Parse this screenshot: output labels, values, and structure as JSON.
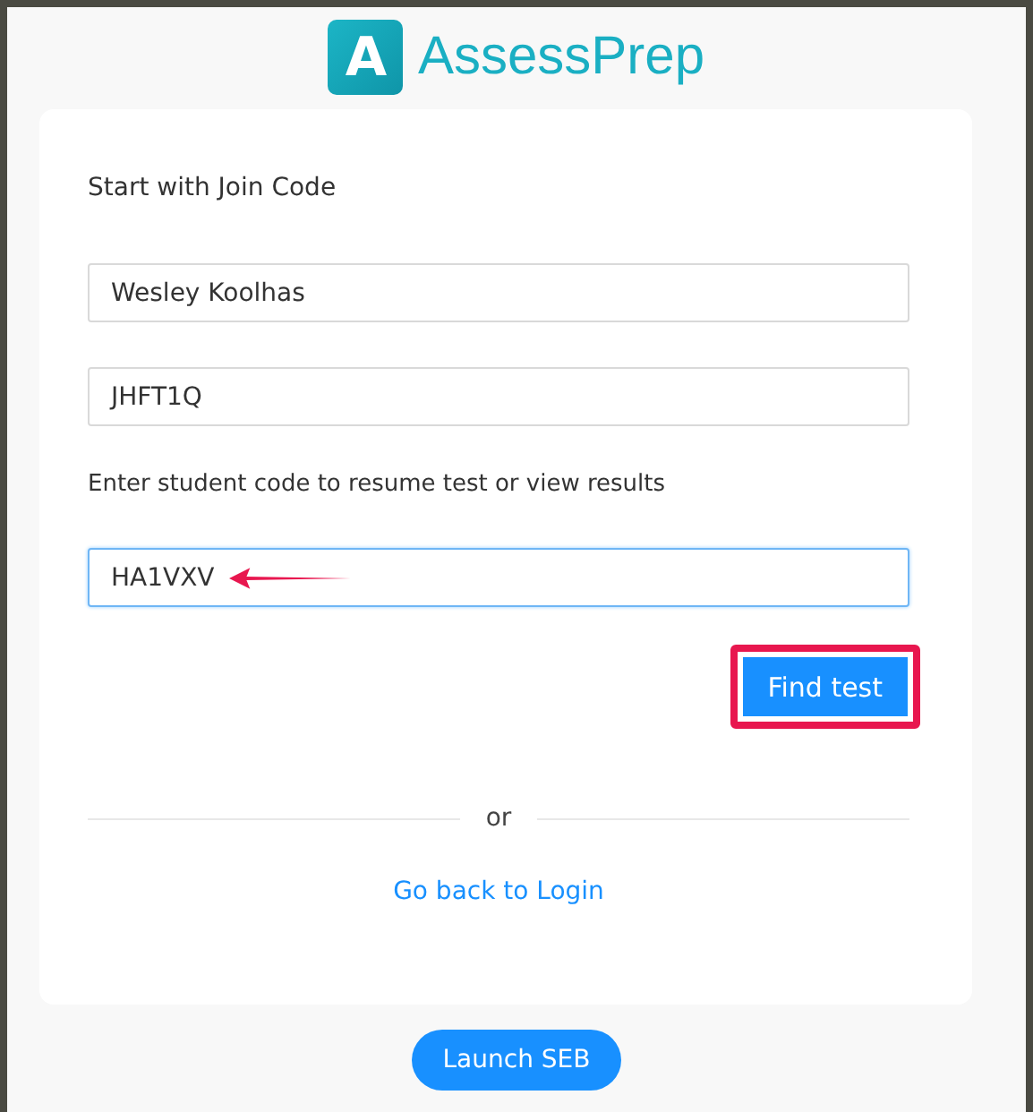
{
  "logo": {
    "text": "AssessPrep",
    "mark": "A"
  },
  "card": {
    "title": "Start with Join Code",
    "fields": [
      {
        "value": "Wesley Koolhas",
        "focused": false,
        "annotated": false
      },
      {
        "value": "JHFT1Q",
        "focused": false,
        "annotated": false
      }
    ],
    "prompt": "Enter student code to resume test or view results",
    "code_field": {
      "value": "HA1VXV",
      "focused": true,
      "annotated": true
    },
    "find_button": {
      "label": "Find test",
      "highlighted": true
    },
    "divider": "or",
    "back_link": "Go back to Login"
  },
  "launch_button": "Launch SEB"
}
